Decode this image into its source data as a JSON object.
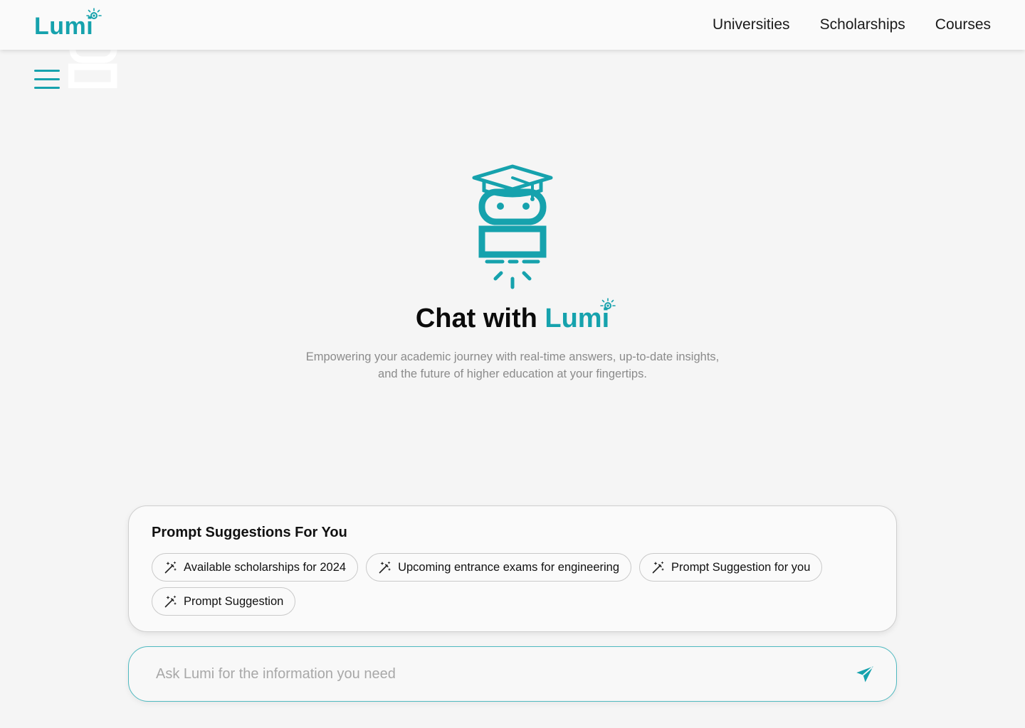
{
  "brand": {
    "name": "Lumi",
    "accent_color": "#16a2ad"
  },
  "nav": {
    "links": [
      {
        "label": "Universities"
      },
      {
        "label": "Scholarships"
      },
      {
        "label": "Courses"
      }
    ]
  },
  "icons": {
    "menu": "hamburger-menu-icon",
    "mascot": "graduation-robot-icon",
    "suggestion": "magic-wand-icon",
    "send": "paper-plane-icon"
  },
  "hero": {
    "title_prefix": "Chat with",
    "title_accent": "Lumi",
    "subtitle": "Empowering your academic journey with real-time answers, up-to-date insights, and the future of higher education at your fingertips."
  },
  "suggestions": {
    "title": "Prompt Suggestions For You",
    "items": [
      {
        "label": "Available scholarships for 2024"
      },
      {
        "label": "Upcoming entrance exams for engineering"
      },
      {
        "label": "Prompt Suggestion for you"
      },
      {
        "label": "Prompt Suggestion"
      }
    ]
  },
  "ask": {
    "placeholder": "Ask Lumi for the information you need",
    "value": ""
  }
}
